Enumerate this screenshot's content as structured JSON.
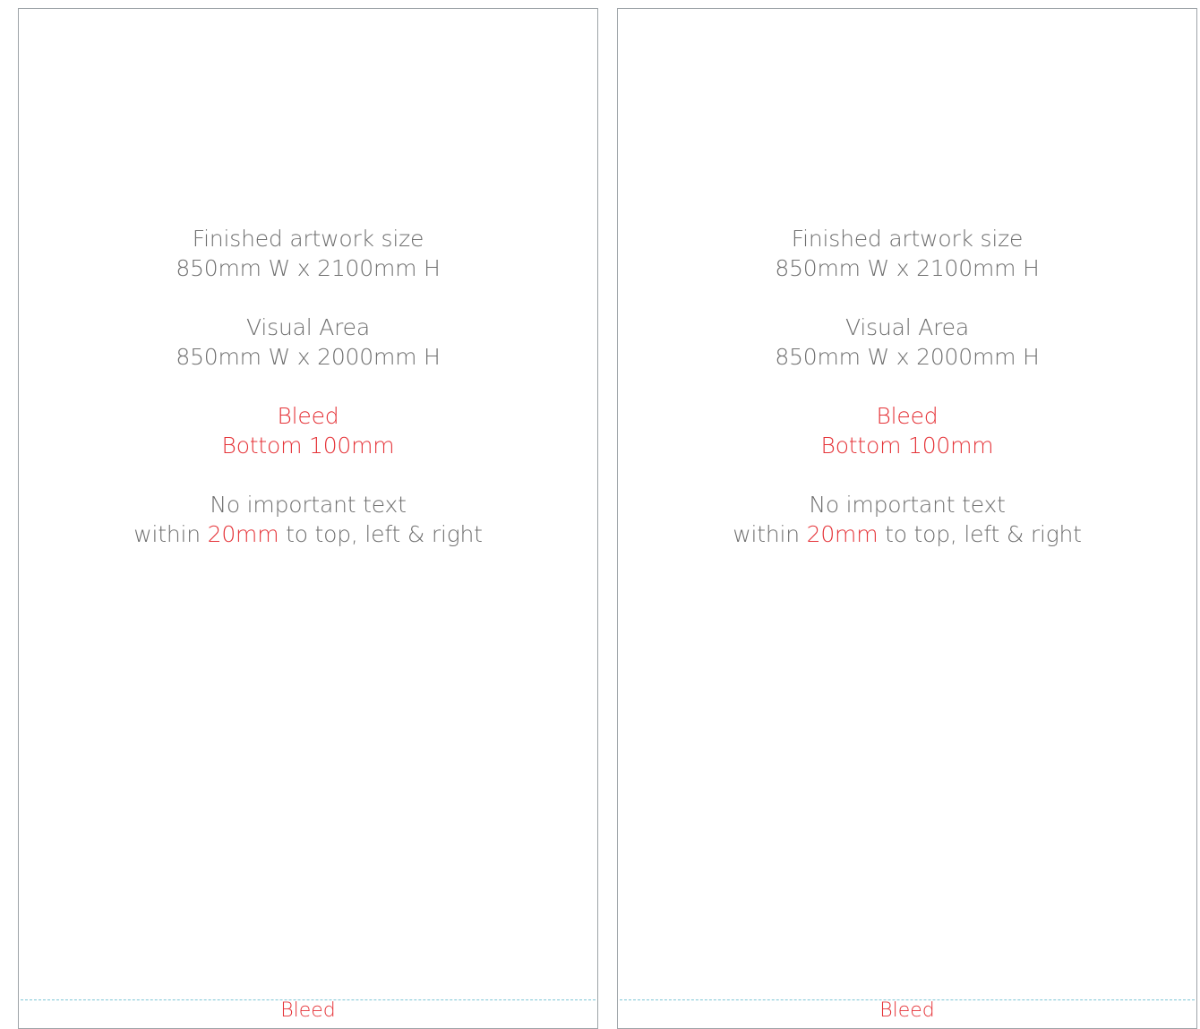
{
  "panels": [
    {
      "finished_title": "Finished artwork size",
      "finished_size": "850mm W x 2100mm H",
      "visual_title": "Visual Area",
      "visual_size": "850mm W x 2000mm H",
      "bleed_title": "Bleed",
      "bleed_size": "Bottom 100mm",
      "note_line1": "No important text",
      "note_within": "within",
      "note_margin": "20mm",
      "note_rest": "to top, left & right",
      "bleed_label": "Bleed"
    },
    {
      "finished_title": "Finished artwork size",
      "finished_size": "850mm W x 2100mm H",
      "visual_title": "Visual Area",
      "visual_size": "850mm W x 2000mm H",
      "bleed_title": "Bleed",
      "bleed_size": "Bottom 100mm",
      "note_line1": "No important text",
      "note_within": "within",
      "note_margin": "20mm",
      "note_rest": "to top, left & right",
      "bleed_label": "Bleed"
    }
  ],
  "colors": {
    "text_gray": "#6f6f6f",
    "accent_red": "#e53338",
    "bleed_line": "#7fc6d6",
    "border": "#9ea4a8"
  }
}
